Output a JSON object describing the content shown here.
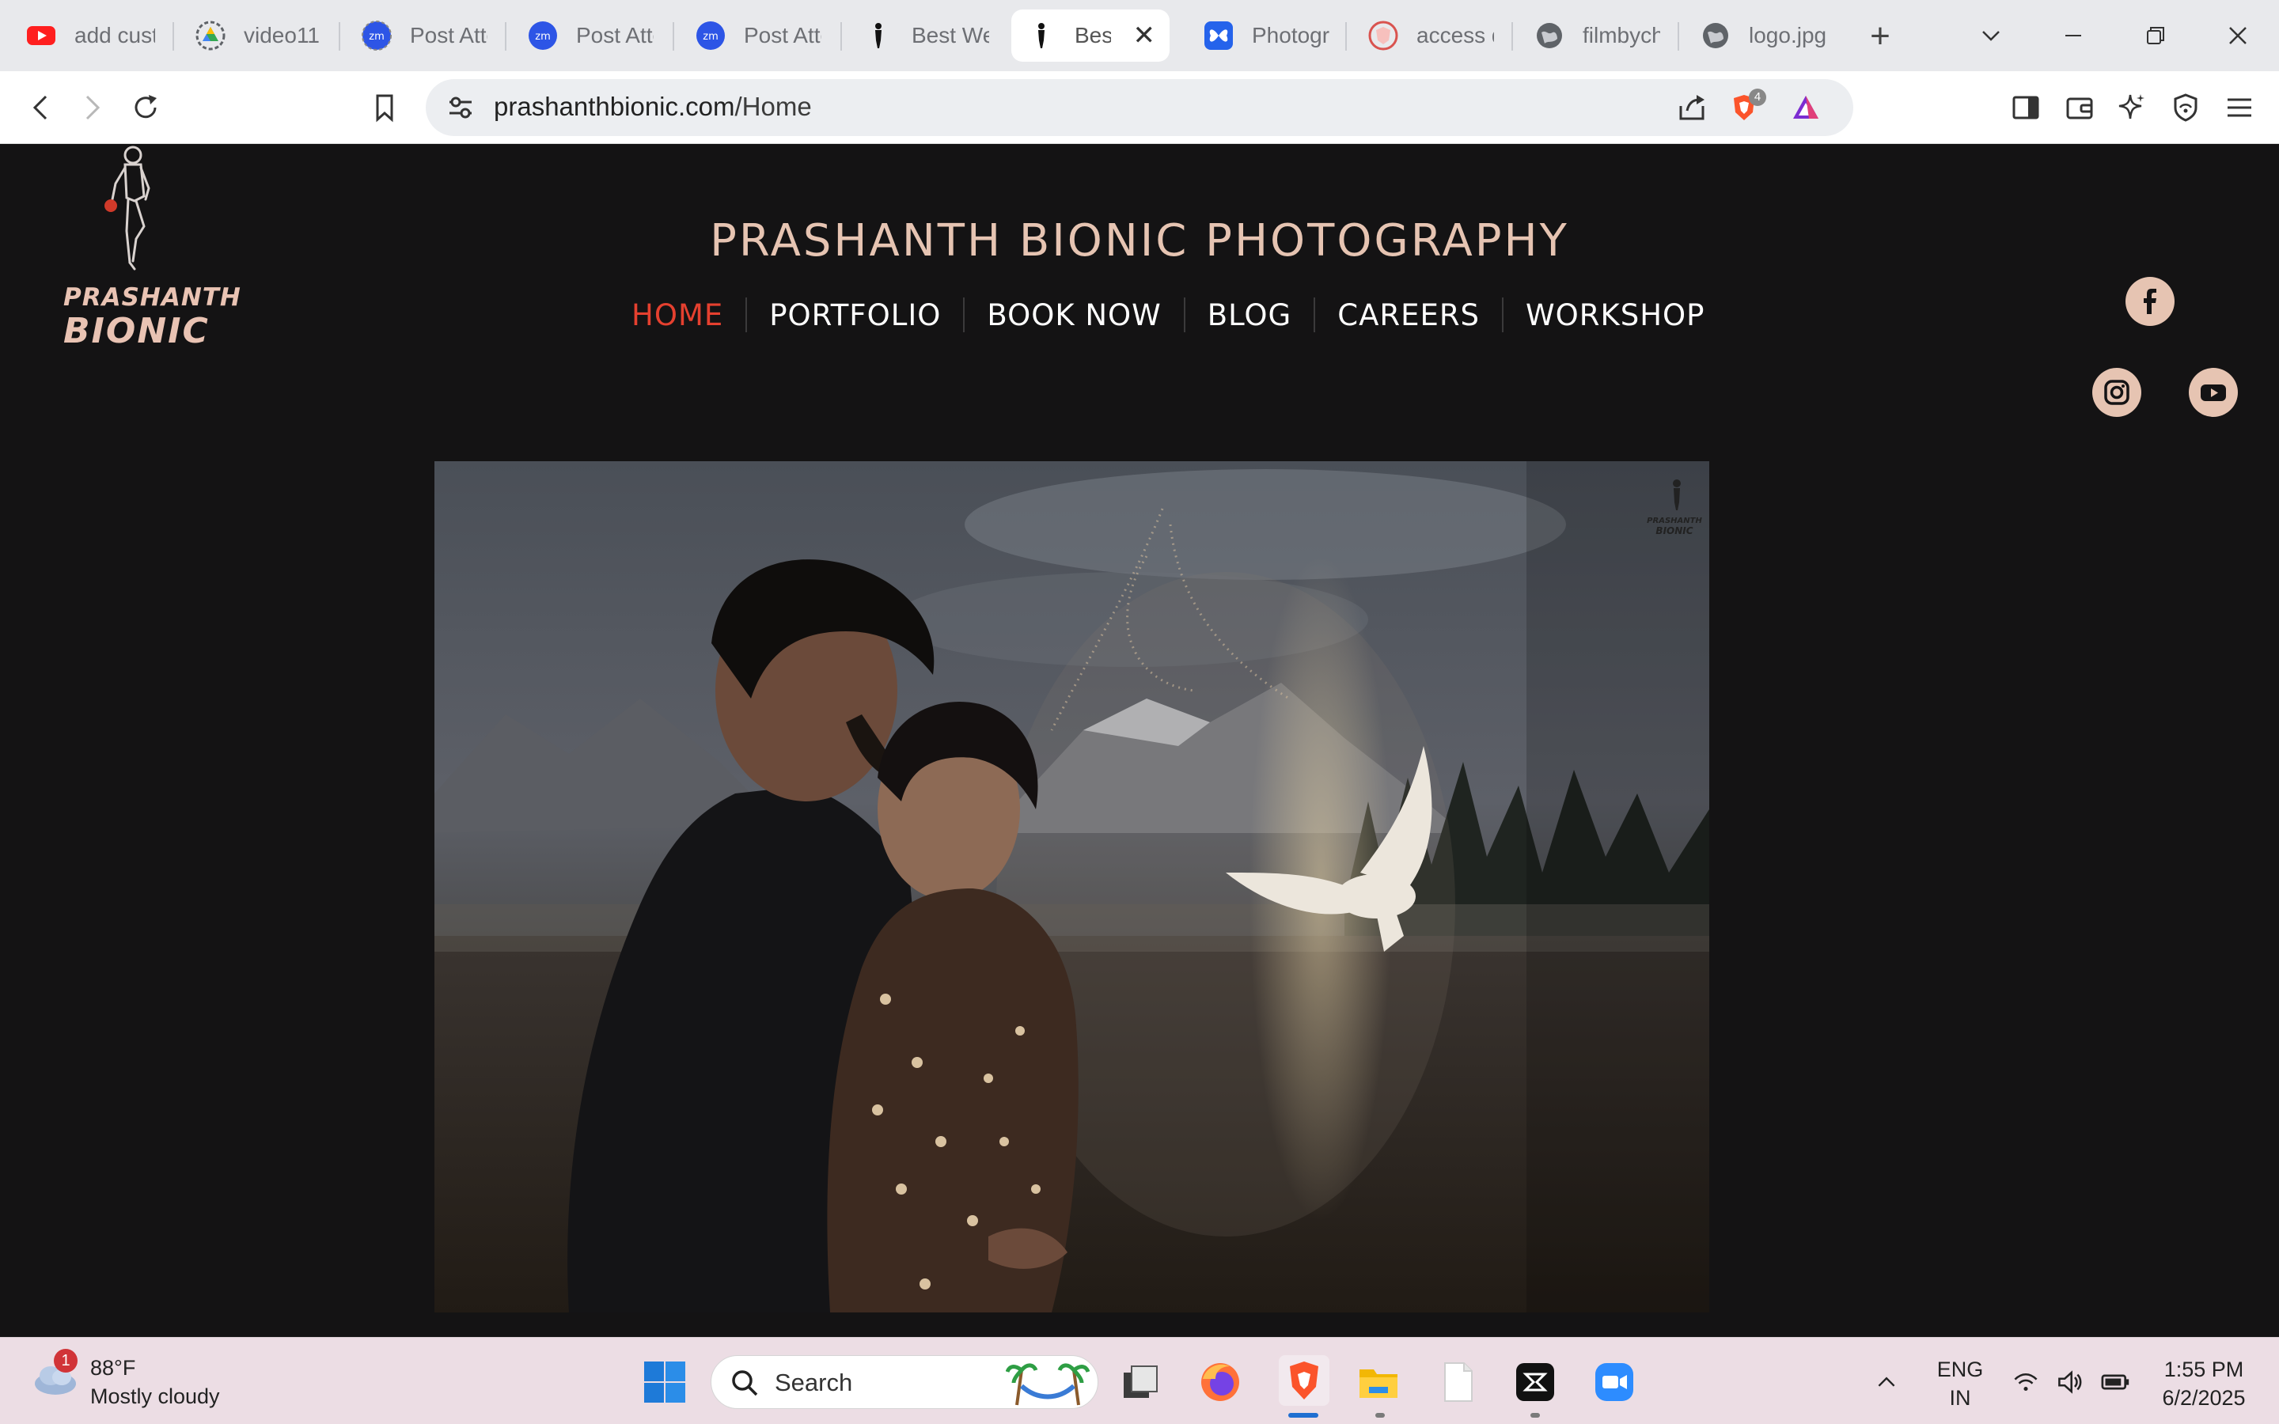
{
  "browser": {
    "tabs": [
      {
        "label": "add cust",
        "icon": "youtube-icon"
      },
      {
        "label": "video11",
        "icon": "google-drive-icon"
      },
      {
        "label": "Post Atte",
        "icon": "zoom-icon"
      },
      {
        "label": "Post Atte",
        "icon": "zoom-icon"
      },
      {
        "label": "Post Atte",
        "icon": "zoom-icon"
      },
      {
        "label": "Best We",
        "icon": "site-logo-icon"
      },
      {
        "label": "Best",
        "icon": "site-logo-icon",
        "active": true
      },
      {
        "label": "Photogr",
        "icon": "butterfly-icon"
      },
      {
        "label": "access d",
        "icon": "shield-tab-icon"
      },
      {
        "label": "filmbych",
        "icon": "globe-icon"
      },
      {
        "label": "logo.jpg",
        "icon": "globe-icon"
      }
    ],
    "url_host": "prashanthbionic.com",
    "url_path": "/Home",
    "shields_count": "4"
  },
  "site": {
    "logo_line1": "PRASHANTH",
    "logo_line2": "BIONIC",
    "title": "PRASHANTH BIONIC PHOTOGRAPHY",
    "menu": [
      {
        "label": "HOME",
        "active": true
      },
      {
        "label": "PORTFOLIO"
      },
      {
        "label": "BOOK NOW"
      },
      {
        "label": "BLOG"
      },
      {
        "label": "CAREERS"
      },
      {
        "label": "WORKSHOP"
      }
    ],
    "social": [
      "facebook-icon",
      "instagram-icon",
      "youtube-icon"
    ],
    "watermark_line1": "PRASHANTH",
    "watermark_line2": "BIONIC",
    "accent_color": "#e5402f",
    "title_color": "#e6c4b2"
  },
  "taskbar": {
    "weather_temp": "88°F",
    "weather_desc": "Mostly cloudy",
    "weather_badge": "1",
    "search_placeholder": "Search",
    "lang_line1": "ENG",
    "lang_line2": "IN",
    "time": "1:55 PM",
    "date": "6/2/2025"
  }
}
